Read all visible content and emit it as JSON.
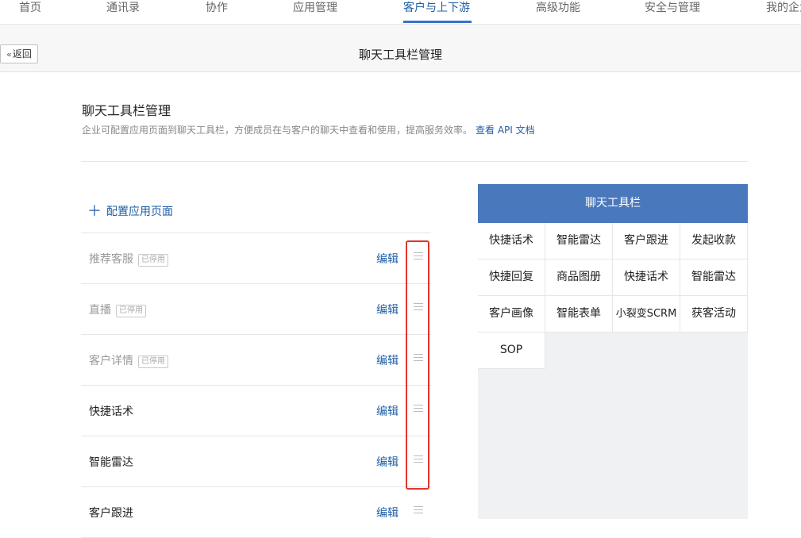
{
  "nav": {
    "items": [
      {
        "label": "首页"
      },
      {
        "label": "通讯录"
      },
      {
        "label": "协作"
      },
      {
        "label": "应用管理"
      },
      {
        "label": "客户与上下游",
        "active": true
      },
      {
        "label": "高级功能"
      },
      {
        "label": "安全与管理"
      },
      {
        "label": "我的企业"
      }
    ]
  },
  "header": {
    "back_label": "返回",
    "title": "聊天工具栏管理"
  },
  "section": {
    "title": "聊天工具栏管理",
    "description": "企业可配置应用页面到聊天工具栏，方便成员在与客户的聊天中查看和使用，提高服务效率。",
    "api_link": "查看 API 文档"
  },
  "config_button": "配置应用页面",
  "list": {
    "edit_label": "编辑",
    "disabled_badge": "已停用",
    "rows": [
      {
        "name": "推荐客服",
        "disabled": true
      },
      {
        "name": "直播",
        "disabled": true
      },
      {
        "name": "客户详情",
        "disabled": true
      },
      {
        "name": "快捷话术",
        "disabled": false
      },
      {
        "name": "智能雷达",
        "disabled": false
      },
      {
        "name": "客户跟进",
        "disabled": false
      }
    ]
  },
  "preview": {
    "title": "聊天工具栏",
    "items": [
      "快捷话术",
      "智能雷达",
      "客户跟进",
      "发起收款",
      "快捷回复",
      "商品图册",
      "快捷话术",
      "智能雷达",
      "客户画像",
      "智能表单",
      "小裂变SCRM",
      "获客活动",
      "SOP"
    ]
  },
  "colors": {
    "accent": "#1f5fa6",
    "preview_header": "#4a78bd",
    "highlight": "#e2352a"
  }
}
